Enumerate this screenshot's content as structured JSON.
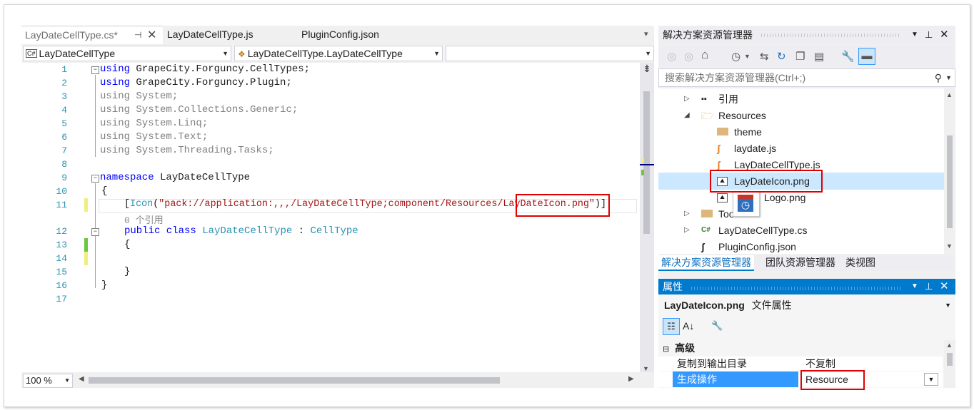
{
  "editor": {
    "tabs": [
      {
        "label": "LayDateCellType.cs*",
        "pin": "⊣",
        "close": "✕"
      },
      {
        "label": "LayDateCellType.js"
      },
      {
        "label": "PluginConfig.json"
      }
    ],
    "tab_overflow": "▾",
    "nav": {
      "class_combo": "LayDateCellType",
      "member_combo": "LayDateCellType.LayDateCellType",
      "third_combo": ""
    },
    "lines": [
      {
        "n": "1"
      },
      {
        "n": "2"
      },
      {
        "n": "3"
      },
      {
        "n": "4"
      },
      {
        "n": "5"
      },
      {
        "n": "6"
      },
      {
        "n": "7"
      },
      {
        "n": "8"
      },
      {
        "n": "9"
      },
      {
        "n": "10"
      },
      {
        "n": "11"
      },
      {
        "n": "12"
      },
      {
        "n": "13"
      },
      {
        "n": "14"
      },
      {
        "n": "15"
      },
      {
        "n": "16"
      },
      {
        "n": "17"
      }
    ],
    "code": {
      "l1_kw": "using",
      "l1_rest": " GrapeCity.Forguncy.CellTypes;",
      "l2_kw": "using",
      "l2_rest": " GrapeCity.Forguncy.Plugin;",
      "l3": "using System;",
      "l4": "using System.Collections.Generic;",
      "l5": "using System.Linq;",
      "l6": "using System.Text;",
      "l7": "using System.Threading.Tasks;",
      "l9_kw": "namespace",
      "l9_rest": " LayDateCellType",
      "l10": "{",
      "l11_open": "[",
      "l11_attr": "Icon",
      "l11_paren": "(",
      "l11_str": "\"pack://application:,,,/LayDateCellType;component/Resources/LayDateIcon.png\"",
      "l11_close": ")]",
      "refs": "0 个引用",
      "l12_kw": "public class",
      "l12_name": " LayDateCellType",
      "l12_colon": " : ",
      "l12_base": "CellType",
      "l13": "{",
      "l15": "}",
      "l16": "}"
    },
    "zoom": "100 %"
  },
  "solution_explorer": {
    "title": "解决方案资源管理器",
    "search_placeholder": "搜索解决方案资源管理器(Ctrl+;)",
    "items": [
      {
        "label": "引用",
        "icon": "references-icon"
      },
      {
        "label": "Resources",
        "icon": "folder-open-icon"
      },
      {
        "label": "theme",
        "icon": "folder-icon"
      },
      {
        "label": "laydate.js",
        "icon": "js-file-icon"
      },
      {
        "label": "LayDateCellType.js",
        "icon": "js-file-icon"
      },
      {
        "label": "LayDateIcon.png",
        "icon": "image-file-icon"
      },
      {
        "label": "Logo.png",
        "icon": "image-file-icon"
      },
      {
        "label": "Too",
        "icon": "folder-icon"
      },
      {
        "label": "LayDateCellType.cs",
        "icon": "csharp-file-icon"
      },
      {
        "label": "PluginConfig.json",
        "icon": "json-file-icon"
      }
    ],
    "bottom_tabs": [
      "解决方案资源管理器",
      "团队资源管理器",
      "类视图"
    ]
  },
  "properties": {
    "title": "属性",
    "object": "LayDateIcon.png",
    "object_type": "文件属性",
    "category": "高级",
    "rows": [
      {
        "name": "复制到输出目录",
        "value": "不复制"
      },
      {
        "name": "生成操作",
        "value": "Resource"
      }
    ]
  },
  "colors": {
    "accent": "#007acc",
    "highlight": "#e00000",
    "selected_row": "#cce8ff"
  }
}
